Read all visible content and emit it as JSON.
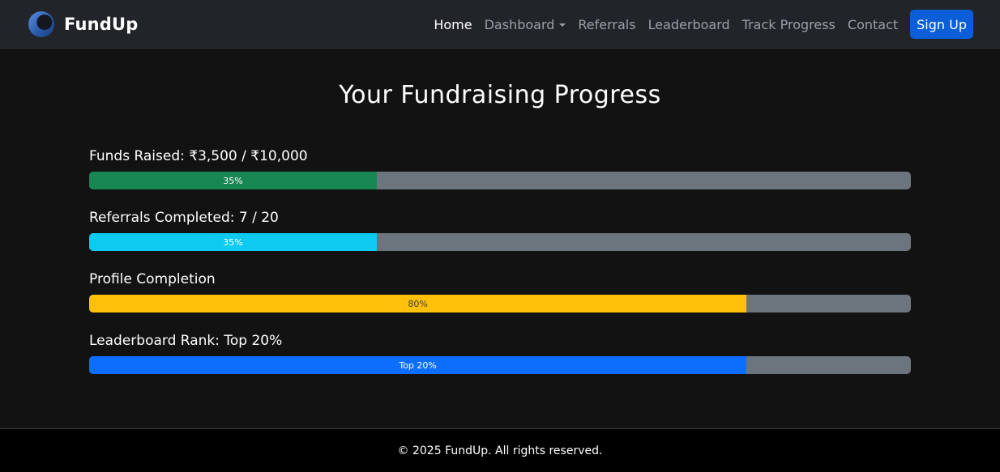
{
  "navbar": {
    "brand": "FundUp",
    "links": [
      {
        "label": "Home"
      },
      {
        "label": "Dashboard"
      },
      {
        "label": "Referrals"
      },
      {
        "label": "Leaderboard"
      },
      {
        "label": "Track Progress"
      },
      {
        "label": "Contact"
      }
    ],
    "signup_label": "Sign Up"
  },
  "main": {
    "title": "Your Fundraising Progress",
    "progress": [
      {
        "label": "Funds Raised: ₹3,500 / ₹10,000",
        "bar_text": "35%",
        "value": 0.35,
        "color": "#198754"
      },
      {
        "label": "Referrals Completed: 7 / 20",
        "bar_text": "35%",
        "value": 0.35,
        "color": "#0dcaf0"
      },
      {
        "label": "Profile Completion",
        "bar_text": "80%",
        "value": 0.8,
        "color": "#ffc107"
      },
      {
        "label": "Leaderboard Rank: Top 20%",
        "bar_text": "Top 20%",
        "value": 0.8,
        "color": "#0d6efd"
      }
    ]
  },
  "footer": {
    "text": "© 2025 FundUp. All rights reserved."
  },
  "colors": {
    "navbar_bg": "#212529",
    "page_bg": "#121212",
    "track_bg": "#6c757d",
    "signup_bg": "#0b5ed7"
  }
}
